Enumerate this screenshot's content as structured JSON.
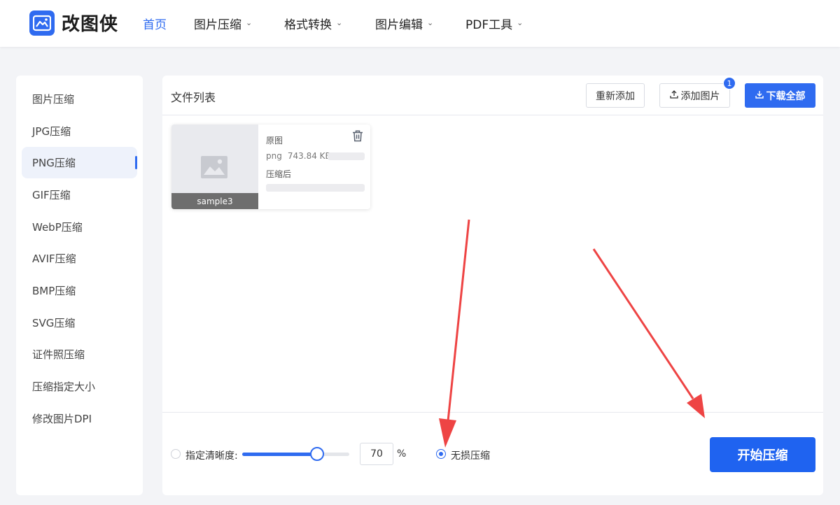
{
  "brand": {
    "name": "改图侠",
    "accent": "#2f6bf0"
  },
  "nav": [
    {
      "label": "首页",
      "active": true,
      "dropdown": false
    },
    {
      "label": "图片压缩",
      "active": false,
      "dropdown": true
    },
    {
      "label": "格式转换",
      "active": false,
      "dropdown": true
    },
    {
      "label": "图片编辑",
      "active": false,
      "dropdown": true
    },
    {
      "label": "PDF工具",
      "active": false,
      "dropdown": true
    }
  ],
  "sidebar": {
    "items": [
      {
        "label": "图片压缩"
      },
      {
        "label": "JPG压缩"
      },
      {
        "label": "PNG压缩",
        "active": true
      },
      {
        "label": "GIF压缩"
      },
      {
        "label": "WebP压缩"
      },
      {
        "label": "AVIF压缩"
      },
      {
        "label": "BMP压缩"
      },
      {
        "label": "SVG压缩"
      },
      {
        "label": "证件照压缩"
      },
      {
        "label": "压缩指定大小"
      },
      {
        "label": "修改图片DPI"
      }
    ]
  },
  "panel": {
    "title": "文件列表",
    "readd_label": "重新添加",
    "add_label": "添加图片",
    "add_badge": "1",
    "download_label": "下载全部"
  },
  "file": {
    "name": "sample3",
    "original_label": "原图",
    "format": "png",
    "size": "743.84 KB",
    "compressed_label": "压缩后"
  },
  "footer": {
    "quality_label": "指定清晰度:",
    "quality_value": "70",
    "quality_fraction": 0.7,
    "percent": "%",
    "lossless_label": "无损压缩",
    "selected_mode": "lossless",
    "start_label": "开始压缩"
  },
  "annotation_color": "#ee4444"
}
